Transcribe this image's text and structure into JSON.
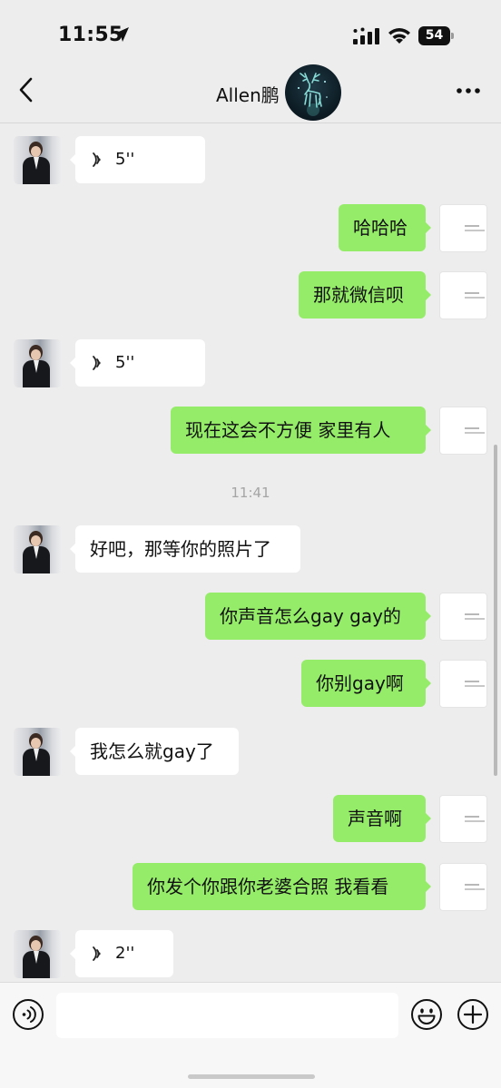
{
  "status_bar": {
    "time": "11:55",
    "battery": "54"
  },
  "header": {
    "title": "Allen鹏"
  },
  "messages": [
    {
      "from": "other",
      "type": "voice",
      "duration": "5''"
    },
    {
      "from": "self",
      "type": "text",
      "text": "哈哈哈"
    },
    {
      "from": "self",
      "type": "text",
      "text": "那就微信呗"
    },
    {
      "from": "other",
      "type": "voice",
      "duration": "5''"
    },
    {
      "from": "self",
      "type": "text",
      "text": "现在这会不方便 家里有人"
    },
    {
      "type": "timestamp",
      "text": "11:41"
    },
    {
      "from": "other",
      "type": "text",
      "text": "好吧，那等你的照片了"
    },
    {
      "from": "self",
      "type": "text",
      "text": "你声音怎么gay gay的"
    },
    {
      "from": "self",
      "type": "text",
      "text": "你别gay啊"
    },
    {
      "from": "other",
      "type": "text",
      "text": "我怎么就gay了"
    },
    {
      "from": "self",
      "type": "text",
      "text": "声音啊"
    },
    {
      "from": "self",
      "type": "text",
      "text": "你发个你跟你老婆合照 我看看"
    },
    {
      "from": "other",
      "type": "voice",
      "duration": "2''"
    }
  ],
  "input_bar": {
    "value": "",
    "placeholder": ""
  },
  "icons": {
    "back": "chevron-left-icon",
    "more": "ellipsis-icon",
    "voice_input": "voice-wave-icon",
    "emoji": "smiley-icon",
    "plus": "plus-circle-icon"
  },
  "colors": {
    "bubble_self": "#95ec69",
    "bubble_other": "#ffffff",
    "background": "#ededed"
  }
}
